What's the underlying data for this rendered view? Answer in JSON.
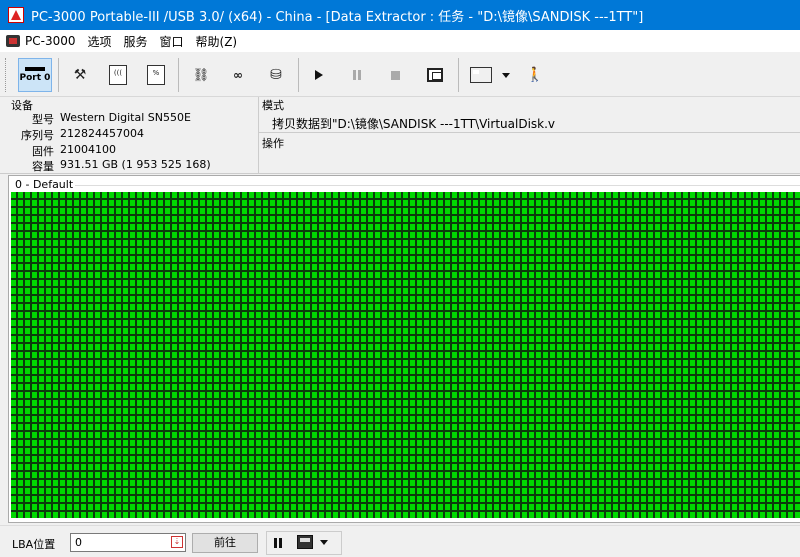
{
  "window": {
    "title": "PC-3000 Portable-III /USB 3.0/ (x64) - China - [Data Extractor : 任务 - \"D:\\镜像\\SANDISK ---1TT\"]"
  },
  "menu": [
    "PC-3000",
    "选项",
    "服务",
    "窗口",
    "帮助(Z)"
  ],
  "toolbar": {
    "port_label": "Port 0",
    "doc1_label": "(((",
    "doc2_label": "%"
  },
  "device": {
    "section_label": "设备",
    "fields": [
      {
        "key": "型号",
        "value": "Western Digital SN550E"
      },
      {
        "key": "序列号",
        "value": "212824457004"
      },
      {
        "key": "固件",
        "value": "21004100"
      },
      {
        "key": "容量",
        "value": "931.51 GB (1 953 525 168)"
      }
    ]
  },
  "mode": {
    "section_label": "模式",
    "text": "拷贝数据到\"D:\\镜像\\SANDISK ---1TT\\VirtualDisk.v",
    "operation_label": "操作"
  },
  "map": {
    "title": "0 - Default",
    "cell_color": "#00d800",
    "status": "all sectors read"
  },
  "bottom": {
    "lba_label": "LBA位置",
    "lba_value": "0",
    "goto_label": "前往"
  }
}
